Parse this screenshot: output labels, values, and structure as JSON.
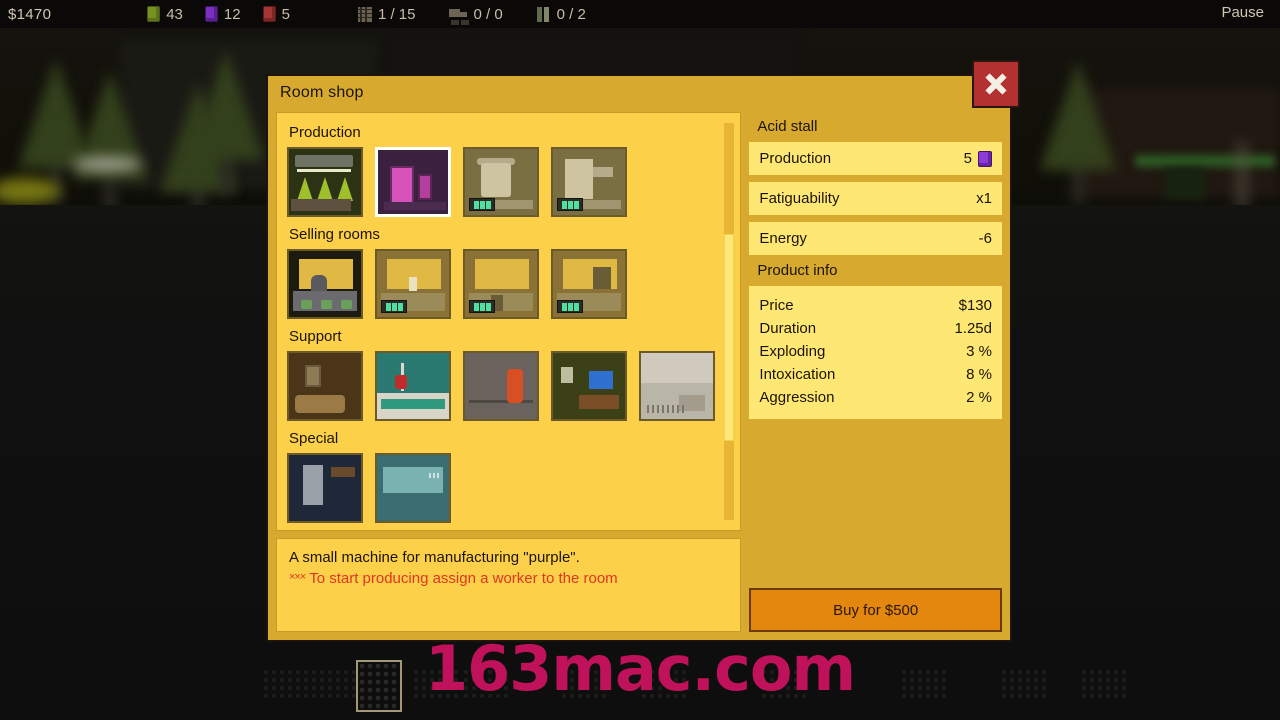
{
  "hud": {
    "money": "$1470",
    "resources": [
      {
        "icon": "brick-green-icon",
        "value": "43"
      },
      {
        "icon": "brick-purple-icon",
        "value": "12"
      },
      {
        "icon": "brick-red-icon",
        "value": "5"
      }
    ],
    "counters": [
      {
        "icon": "building-icon",
        "value": "1 / 15"
      },
      {
        "icon": "truck-icon",
        "value": "0 / 0"
      },
      {
        "icon": "people-icon",
        "value": "0 / 2"
      }
    ],
    "pause_label": "Pause"
  },
  "dialog": {
    "title": "Room shop",
    "close_label": "X"
  },
  "categories": [
    {
      "name": "Production",
      "rooms": [
        {
          "art": "r1",
          "locked": false,
          "selected": false,
          "name": "grow-room"
        },
        {
          "art": "r2",
          "locked": false,
          "selected": true,
          "name": "acid-stall"
        },
        {
          "art": "r3",
          "locked": true,
          "selected": false,
          "name": "cook-room"
        },
        {
          "art": "r4",
          "locked": true,
          "selected": false,
          "name": "lab-room"
        }
      ]
    },
    {
      "name": "Selling rooms",
      "rooms": [
        {
          "art": "s1",
          "locked": false,
          "selected": false,
          "name": "bar-room"
        },
        {
          "art": "s2",
          "locked": true,
          "selected": false,
          "name": "shop-room"
        },
        {
          "art": "s3",
          "locked": true,
          "selected": false,
          "name": "kiosk-room"
        },
        {
          "art": "s4",
          "locked": true,
          "selected": false,
          "name": "counter-room"
        }
      ]
    },
    {
      "name": "Support",
      "rooms": [
        {
          "art": "p1",
          "locked": false,
          "selected": false,
          "name": "lounge-room"
        },
        {
          "art": "p2",
          "locked": false,
          "selected": false,
          "name": "medical-room"
        },
        {
          "art": "p3",
          "locked": false,
          "selected": false,
          "name": "corridor-room"
        },
        {
          "art": "p4",
          "locked": false,
          "selected": false,
          "name": "office-room"
        },
        {
          "art": "p5",
          "locked": false,
          "selected": false,
          "name": "storage-room"
        }
      ]
    },
    {
      "name": "Special",
      "rooms": [
        {
          "art": "x1",
          "locked": false,
          "selected": false,
          "name": "special-room-1"
        },
        {
          "art": "x2",
          "locked": false,
          "selected": false,
          "name": "special-room-2"
        }
      ]
    }
  ],
  "description": {
    "line1": "A small machine for manufacturing \"purple\".",
    "stars": "×××",
    "line2": "To start producing assign a worker to the room"
  },
  "details": {
    "room_name": "Acid stall",
    "stats": [
      {
        "label": "Production",
        "value": "5",
        "chip": "purple-brick-icon"
      },
      {
        "label": "Fatiguability",
        "value": "x1",
        "chip": null
      },
      {
        "label": "Energy",
        "value": "-6",
        "chip": null
      }
    ],
    "product_info_header": "Product info",
    "product_info": [
      {
        "label": "Price",
        "value": "$130"
      },
      {
        "label": "Duration",
        "value": "1.25d"
      },
      {
        "label": "Exploding",
        "value": "3 %"
      },
      {
        "label": "Intoxication",
        "value": "8 %"
      },
      {
        "label": "Aggression",
        "value": "2 %"
      }
    ],
    "buy_label": "Buy for $500"
  },
  "watermark": "163mac.com",
  "colors": {
    "panel": "#d8a92f",
    "list_bg": "#fdd04a",
    "stat_bg": "#ffe773",
    "buy_button": "#e3870f",
    "close_button": "#b43131",
    "warning_text": "#e0361f",
    "watermark": "#c0125a"
  }
}
